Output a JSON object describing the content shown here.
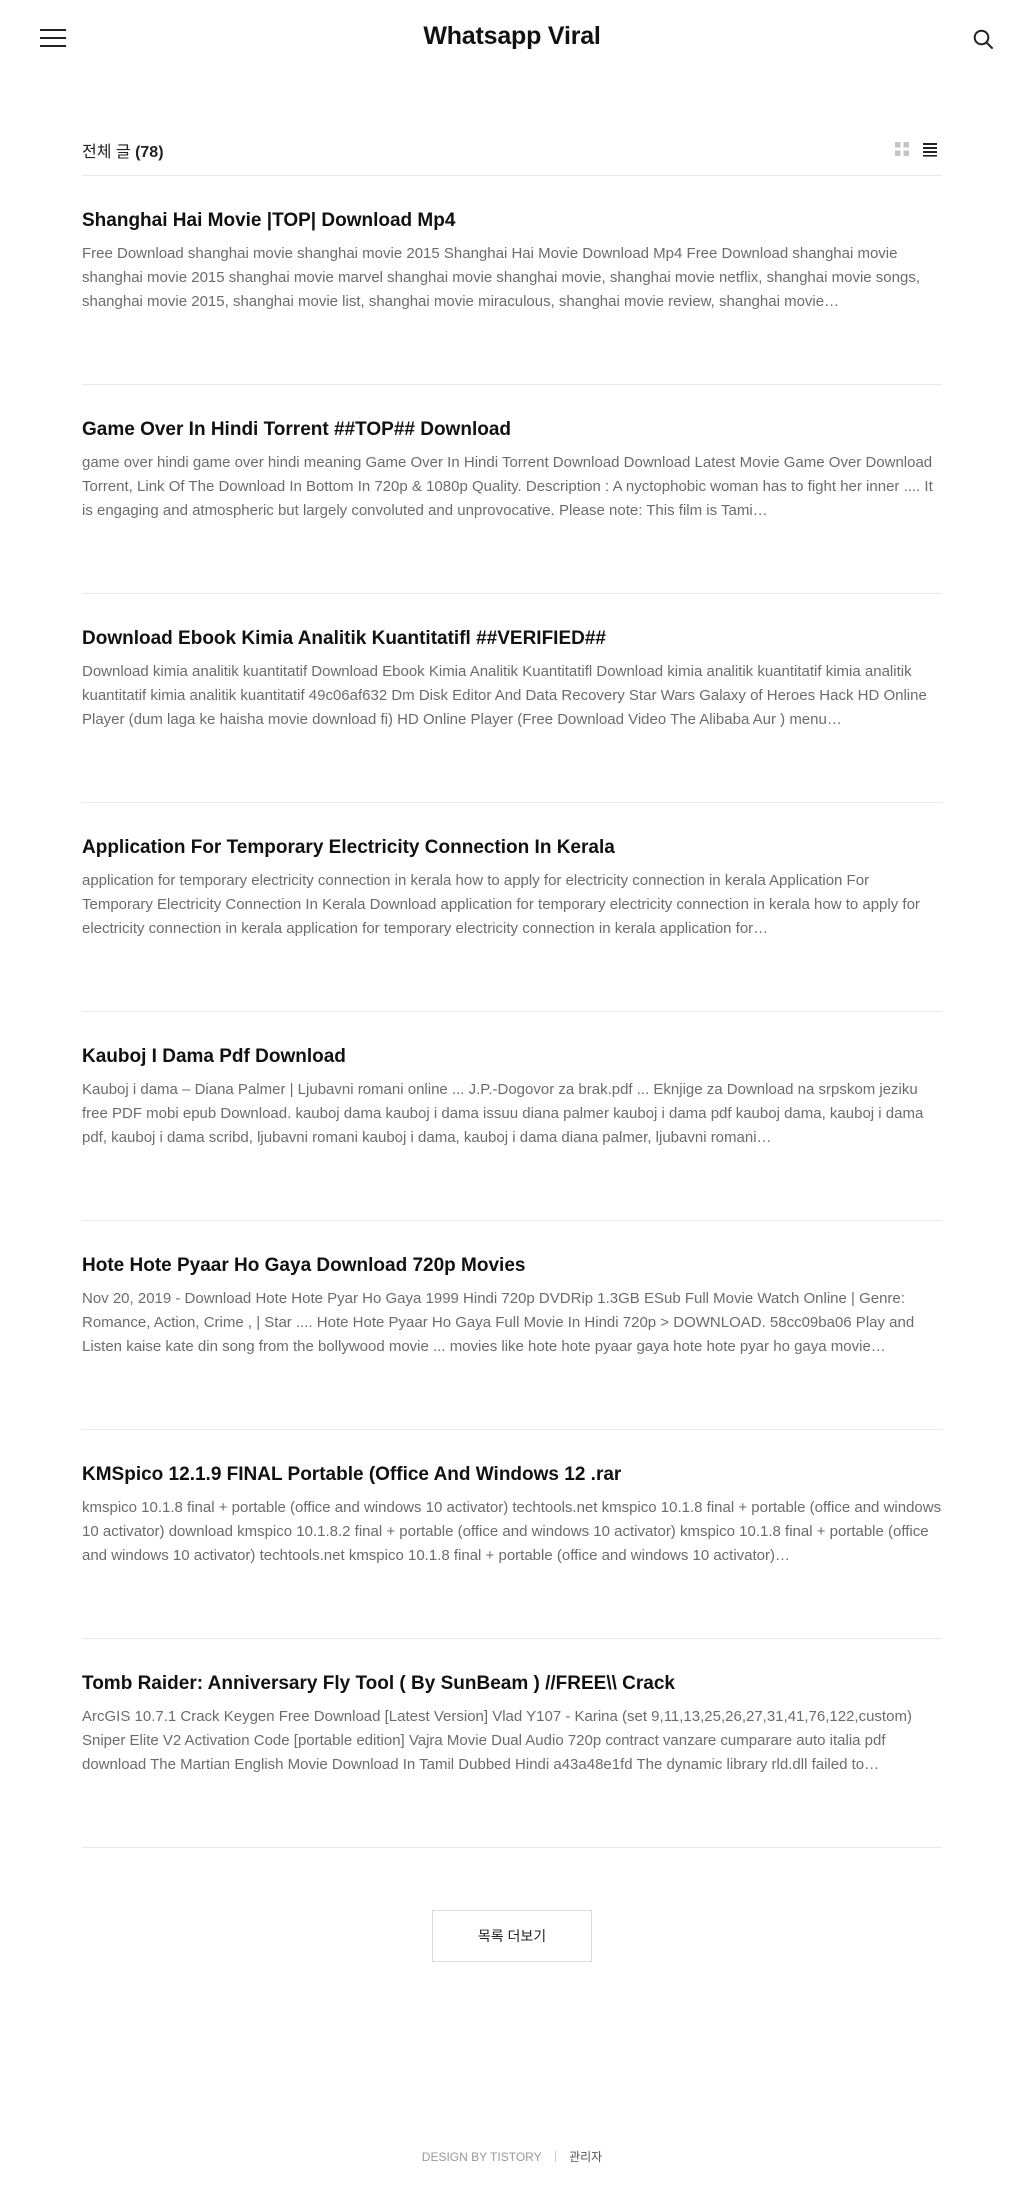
{
  "header": {
    "title": "Whatsapp Viral",
    "menu_icon": "hamburger-menu-icon",
    "search_icon": "search-icon"
  },
  "list": {
    "label": "전체 글",
    "count": "(78)",
    "views": [
      "grid-view-icon",
      "list-view-icon"
    ]
  },
  "posts": [
    {
      "title": "Shanghai Hai Movie |TOP| Download Mp4",
      "excerpt": "Free Download shanghai movie shanghai movie 2015 Shanghai Hai Movie Download Mp4 Free Download shanghai movie shanghai movie 2015 shanghai movie marvel shanghai movie shanghai movie, shanghai movie netflix, shanghai movie songs, shanghai movie 2015, shanghai movie list, shanghai movie miraculous, shanghai movie review, shanghai movie…"
    },
    {
      "title": "Game Over In Hindi Torrent ##TOP## Download",
      "excerpt": "game over hindi game over hindi meaning Game Over In Hindi Torrent Download Download Latest Movie Game Over Download Torrent, Link Of The Download In Bottom In 720p & 1080p Quality. Description : A nyctophobic woman has to fight her inner .... It is engaging and atmospheric but largely convoluted and unprovocative. Please note: This film is Tami…"
    },
    {
      "title": "Download Ebook Kimia Analitik Kuantitatifl ##VERIFIED##",
      "excerpt": "Download kimia analitik kuantitatif Download Ebook Kimia Analitik Kuantitatifl Download kimia analitik kuantitatif kimia analitik kuantitatif kimia analitik kuantitatif 49c06af632 Dm Disk Editor And Data Recovery Star Wars Galaxy of Heroes Hack HD Online Player (dum laga ke haisha movie download fi) HD Online Player (Free Download Video The Alibaba Aur ) menu…"
    },
    {
      "title": "Application For Temporary Electricity Connection In Kerala",
      "excerpt": "application for temporary electricity connection in kerala how to apply for electricity connection in kerala Application For Temporary Electricity Connection In Kerala Download application for temporary electricity connection in kerala how to apply for electricity connection in kerala application for temporary electricity connection in kerala application for…"
    },
    {
      "title": "Kauboj I Dama Pdf Download",
      "excerpt": "Kauboj i dama – Diana Palmer | Ljubavni romani online ... J.P.-Dogovor za brak.pdf ... Eknjige za Download na srpskom jeziku free PDF mobi epub Download. kauboj dama kauboj i dama issuu diana palmer kauboj i dama pdf kauboj dama, kauboj i dama pdf, kauboj i dama scribd, ljubavni romani kauboj i dama, kauboj i dama diana palmer, ljubavni romani…"
    },
    {
      "title": "Hote Hote Pyaar Ho Gaya Download 720p Movies",
      "excerpt": "Nov 20, 2019 - Download Hote Hote Pyar Ho Gaya 1999 Hindi 720p DVDRip 1.3GB ESub Full Movie Watch Online | Genre: Romance, Action, Crime , | Star .... Hote Hote Pyaar Ho Gaya Full Movie In Hindi 720p > DOWNLOAD. 58cc09ba06 Play and Listen kaise kate din song from the bollywood movie ... movies like hote hote pyaar gaya hote hote pyar ho gaya movie…"
    },
    {
      "title": "KMSpico 12.1.9 FINAL Portable (Office And Windows 12 .rar",
      "excerpt": "kmspico 10.1.8 final + portable (office and windows 10 activator) techtools.net kmspico 10.1.8 final + portable (office and windows 10 activator) download kmspico 10.1.8.2 final + portable (office and windows 10 activator) kmspico 10.1.8 final + portable (office and windows 10 activator) techtools.net kmspico 10.1.8 final + portable (office and windows 10 activator)…"
    },
    {
      "title": "Tomb Raider: Anniversary Fly Tool ( By SunBeam ) //FREE\\\\ Crack",
      "excerpt": "ArcGIS 10.7.1 Crack Keygen Free Download [Latest Version] Vlad Y107 - Karina (set 9,11,13,25,26,27,31,41,76,122,custom) Sniper Elite V2 Activation Code [portable edition] Vajra Movie Dual Audio 720p contract vanzare cumparare auto italia pdf download The Martian English Movie Download In Tamil Dubbed Hindi a43a48e1fd The dynamic library rld.dll failed to…"
    }
  ],
  "more_button": "목록 더보기",
  "footer": {
    "credit": "DESIGN BY TISTORY",
    "admin": "관리자"
  }
}
